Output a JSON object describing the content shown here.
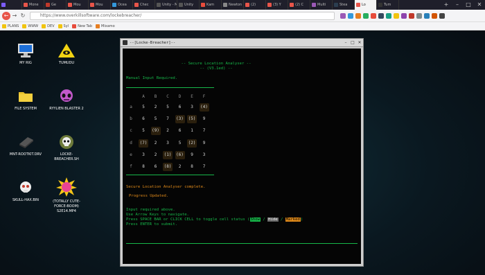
{
  "browser": {
    "tabs": [
      {
        "label": "",
        "color": "#7c5cff"
      },
      {
        "label": "Mone",
        "color": "#e8554a"
      },
      {
        "label": "Ge",
        "color": "#c0392b"
      },
      {
        "label": "Mou",
        "color": "#e8554a"
      },
      {
        "label": "Mou",
        "color": "#e8554a"
      },
      {
        "label": "Ocea",
        "color": "#3498db"
      },
      {
        "label": "Chec",
        "color": "#e8554a"
      },
      {
        "label": "Unity - M",
        "color": "#555555"
      },
      {
        "label": "Unity",
        "color": "#555555"
      },
      {
        "label": "Kam",
        "color": "#e74c3c"
      },
      {
        "label": "Newton",
        "color": "#888888"
      },
      {
        "label": "(2)",
        "color": "#e8554a"
      },
      {
        "label": "(3) Y",
        "color": "#e8554a"
      },
      {
        "label": "(2) C",
        "color": "#e8554a"
      },
      {
        "label": "Multi",
        "color": "#9b59b6"
      },
      {
        "label": "Stea",
        "color": "#2c3e50"
      },
      {
        "label": "Lo",
        "color": "#e8554a"
      },
      {
        "label": "Tum",
        "color": "#333333"
      }
    ],
    "url": "https://www.overkillsoftware.com/lockebreacher/",
    "bookmarks": [
      {
        "label": "PLANS",
        "color": "#f1c40f"
      },
      {
        "label": "WWW",
        "color": "#f1c40f"
      },
      {
        "label": "DEV",
        "color": "#f1c40f"
      },
      {
        "label": "Syl",
        "color": "#f1c40f"
      },
      {
        "label": "New Tab",
        "color": "#e74c3c"
      },
      {
        "label": "Mixamo",
        "color": "#e67e22"
      }
    ]
  },
  "desktop": {
    "icons": [
      {
        "label": "MY RIG",
        "kind": "computer-icon"
      },
      {
        "label": "TUMUDU",
        "kind": "eye-triangle-icon"
      },
      {
        "label": "FILE SYSTEM",
        "kind": "folder-icon"
      },
      {
        "label": "RYYLIEN BLASTER 2",
        "kind": "alien-icon"
      },
      {
        "label": "MNT-ROOTKIT.DRV",
        "kind": "drive-icon"
      },
      {
        "label": "LOCKE-BREACHER.SH",
        "kind": "skull-icon"
      },
      {
        "label": "SKULL-HAX.BIN",
        "kind": "skull-red-icon"
      },
      {
        "label": "(TOTALLY CUTE-FORCE-BOOM) S2E14.MP4",
        "kind": "starburst-icon"
      }
    ]
  },
  "terminal": {
    "title": "--[Locke-Breacher]--",
    "header1": "-- Secure Location Analyser --",
    "header2": "-- (V3.1ed) --",
    "prompt": "Manual Input Required.",
    "columns": [
      "A",
      "B",
      "C",
      "D",
      "E",
      "F"
    ],
    "rows": [
      {
        "label": "a",
        "cells": [
          "5",
          "2",
          "5",
          "6",
          "3",
          "(4)"
        ]
      },
      {
        "label": "b",
        "cells": [
          "6",
          "5",
          "7",
          "(3)",
          "(5)",
          "9"
        ]
      },
      {
        "label": "c",
        "cells": [
          "5",
          "(9)",
          "2",
          "6",
          "1",
          "7"
        ]
      },
      {
        "label": "d",
        "cells": [
          "(7)",
          "2",
          "3",
          "5",
          "(2)",
          "9"
        ]
      },
      {
        "label": "e",
        "cells": [
          "3",
          "2",
          "(1)",
          "(6)",
          "9",
          "3"
        ]
      },
      {
        "label": "f",
        "cells": [
          "8",
          "6",
          "(8)",
          "2",
          "8",
          "7"
        ]
      }
    ],
    "complete": "Secure Location Analyser complete.",
    "progress": "Progress Updated.",
    "instr1": "Input required above.",
    "instr2": "Use Arrow Keys to navigate.",
    "instr3_pre": "Press SPACE BAR or CLICK CELL to toggle cell status (",
    "btn_show": "Show",
    "btn_hide": "Hide",
    "btn_marked": "Marked",
    "instr3_post": ")",
    "instr4": "Press ENTER to submit.",
    "sep": " / "
  }
}
